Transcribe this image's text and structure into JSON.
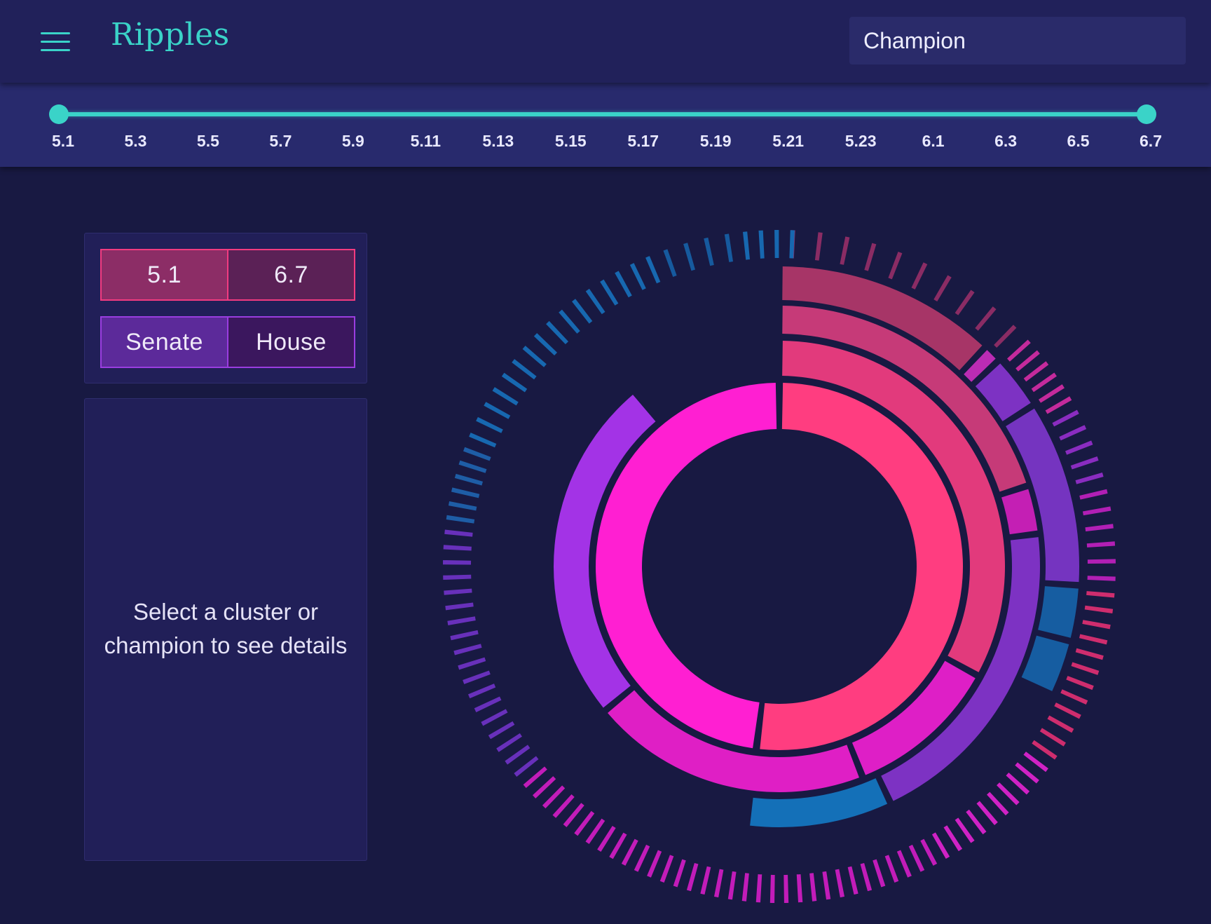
{
  "app": {
    "title": "Ripples"
  },
  "search": {
    "placeholder": "Champion"
  },
  "patch_slider": {
    "ticks": [
      "5.1",
      "5.3",
      "5.5",
      "5.7",
      "5.9",
      "5.11",
      "5.13",
      "5.15",
      "5.17",
      "5.19",
      "5.21",
      "5.23",
      "6.1",
      "6.3",
      "6.5",
      "6.7"
    ],
    "range_start": "5.1",
    "range_end": "6.7"
  },
  "controls": {
    "patch_from": "5.1",
    "patch_to": "6.7",
    "chamber_left": "Senate",
    "chamber_right": "House"
  },
  "details": {
    "line1": "Select a cluster or",
    "line2": "champion to see details"
  },
  "colors": {
    "accent": "#3ad3c8",
    "background": "#181942",
    "panel": "#211f58"
  },
  "chart_data": {
    "type": "sunburst",
    "rings": [
      {
        "level": 1,
        "segments": [
          {
            "value": 52,
            "color": "#ff3d80"
          },
          {
            "value": 48,
            "color": "#ff1fd2"
          }
        ]
      },
      {
        "level": 2,
        "segments": [
          {
            "value": 33,
            "color": "#e23a7c"
          },
          {
            "value": 11,
            "color": "#de1fc6"
          },
          {
            "value": 20,
            "color": "#df1fc5"
          },
          {
            "value": 25,
            "color": "#a333e6"
          }
        ]
      },
      {
        "level": 3,
        "segments": [
          {
            "value": 20,
            "color": "#c63a78"
          },
          {
            "value": 3,
            "color": "#c41fb4"
          },
          {
            "value": 20,
            "color": "#7d32c3"
          },
          {
            "value": 9,
            "color": "#1470b8"
          }
        ]
      },
      {
        "level": 4,
        "segments": [
          {
            "value": 12,
            "color": "#a73567"
          },
          {
            "value": 1,
            "color": "#bb2cb4"
          },
          {
            "value": 3,
            "color": "#7d32c3"
          },
          {
            "value": 10,
            "color": "#7534c0"
          },
          {
            "value": 3,
            "color": "#165da1"
          },
          {
            "value": 3,
            "color": "#165da1"
          }
        ]
      },
      {
        "level": 5,
        "segments": [
          {
            "value": 13,
            "count": 10,
            "color": "#8a2c64"
          },
          {
            "value": 4,
            "count": 6,
            "color": "#c42a9c"
          },
          {
            "value": 4,
            "count": 5,
            "color": "#8a2cc0"
          },
          {
            "value": 5,
            "count": 6,
            "color": "#b21fb5"
          },
          {
            "value": 9,
            "count": 12,
            "color": "#cf2d6e"
          },
          {
            "value": 7,
            "count": 10,
            "color": "#d022c5"
          },
          {
            "value": 18,
            "count": 27,
            "color": "#c21cb9"
          },
          {
            "value": 4,
            "count": 6,
            "color": "#c21cb9"
          },
          {
            "value": 13,
            "count": 18,
            "color": "#6830bb"
          },
          {
            "value": 4,
            "count": 6,
            "color": "#1e5da6"
          },
          {
            "value": 13,
            "count": 16,
            "color": "#1768b0"
          },
          {
            "value": 4,
            "count": 4,
            "color": "#165a9e"
          },
          {
            "value": 3,
            "count": 4,
            "color": "#1768b0"
          }
        ]
      }
    ]
  }
}
